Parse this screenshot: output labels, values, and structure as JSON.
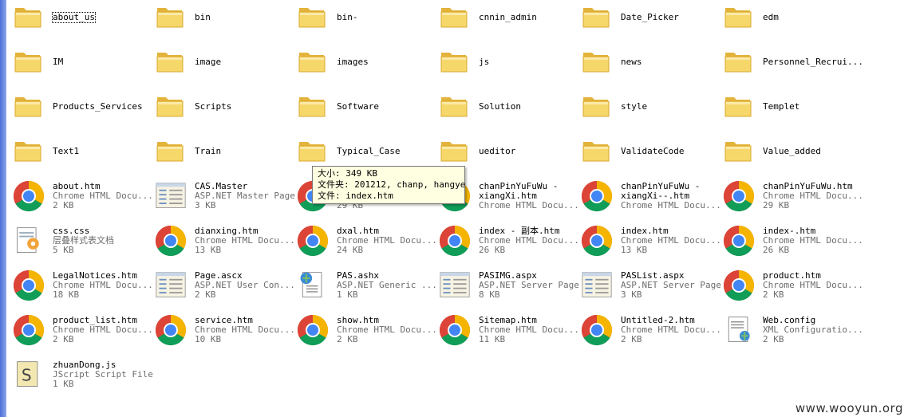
{
  "folders": [
    {
      "name": "about_us",
      "selected": true
    },
    {
      "name": "bin"
    },
    {
      "name": "bin-"
    },
    {
      "name": "cnnin_admin"
    },
    {
      "name": "Date_Picker"
    },
    {
      "name": "edm"
    },
    {
      "name": "IM"
    },
    {
      "name": "image"
    },
    {
      "name": "images"
    },
    {
      "name": "js"
    },
    {
      "name": "news"
    },
    {
      "name": "Personnel_Recrui..."
    },
    {
      "name": "Products_Services"
    },
    {
      "name": "Scripts"
    },
    {
      "name": "Software"
    },
    {
      "name": "Solution"
    },
    {
      "name": "style"
    },
    {
      "name": "Templet"
    },
    {
      "name": "Text1"
    },
    {
      "name": "Train"
    },
    {
      "name": "Typical_Case"
    },
    {
      "name": "ueditor"
    },
    {
      "name": "ValidateCode"
    },
    {
      "name": "Value_added"
    }
  ],
  "files": [
    {
      "name": "about.htm",
      "type": "Chrome HTML Docu...",
      "size": "2 KB",
      "icon": "chrome-icon"
    },
    {
      "name": "CAS.Master",
      "type": "ASP.NET Master Page",
      "size": "3 KB",
      "icon": "master-page-icon"
    },
    {
      "name": "",
      "type": "",
      "size": "29 KB",
      "icon": "chrome-icon"
    },
    {
      "name": "chanPinYuFuWu -",
      "name2": "xiangXi.htm",
      "type": "Chrome HTML Docu...",
      "size": "",
      "icon": "chrome-icon"
    },
    {
      "name": "chanPinYuFuWu -",
      "name2": "xiangXi--.htm",
      "type": "Chrome HTML Docu...",
      "size": "",
      "icon": "chrome-icon"
    },
    {
      "name": "chanPinYuFuWu.htm",
      "type": "Chrome HTML Docu...",
      "size": "29 KB",
      "icon": "chrome-icon"
    },
    {
      "name": "css.css",
      "type": "层叠样式表文档",
      "size": "5 KB",
      "icon": "css-icon"
    },
    {
      "name": "dianxing.htm",
      "type": "Chrome HTML Docu...",
      "size": "13 KB",
      "icon": "chrome-icon"
    },
    {
      "name": "dxal.htm",
      "type": "Chrome HTML Docu...",
      "size": "24 KB",
      "icon": "chrome-icon"
    },
    {
      "name": "index - 副本.htm",
      "type": "Chrome HTML Docu...",
      "size": "26 KB",
      "icon": "chrome-icon"
    },
    {
      "name": "index.htm",
      "type": "Chrome HTML Docu...",
      "size": "13 KB",
      "icon": "chrome-icon"
    },
    {
      "name": "index-.htm",
      "type": "Chrome HTML Docu...",
      "size": "26 KB",
      "icon": "chrome-icon"
    },
    {
      "name": "LegalNotices.htm",
      "type": "Chrome HTML Docu...",
      "size": "18 KB",
      "icon": "chrome-icon"
    },
    {
      "name": "Page.ascx",
      "type": "ASP.NET User Con...",
      "size": "2 KB",
      "icon": "user-control-icon"
    },
    {
      "name": "PAS.ashx",
      "type": "ASP.NET Generic ...",
      "size": "1 KB",
      "icon": "generic-handler-icon"
    },
    {
      "name": "PASIMG.aspx",
      "type": "ASP.NET Server Page",
      "size": "8 KB",
      "icon": "server-page-icon"
    },
    {
      "name": "PASList.aspx",
      "type": "ASP.NET Server Page",
      "size": "3 KB",
      "icon": "server-page-icon"
    },
    {
      "name": "product.htm",
      "type": "Chrome HTML Docu...",
      "size": "2 KB",
      "icon": "chrome-icon"
    },
    {
      "name": "product_list.htm",
      "type": "Chrome HTML Docu...",
      "size": "2 KB",
      "icon": "chrome-icon"
    },
    {
      "name": "service.htm",
      "type": "Chrome HTML Docu...",
      "size": "10 KB",
      "icon": "chrome-icon"
    },
    {
      "name": "show.htm",
      "type": "Chrome HTML Docu...",
      "size": "2 KB",
      "icon": "chrome-icon"
    },
    {
      "name": "Sitemap.htm",
      "type": "Chrome HTML Docu...",
      "size": "11 KB",
      "icon": "chrome-icon"
    },
    {
      "name": "Untitled-2.htm",
      "type": "Chrome HTML Docu...",
      "size": "2 KB",
      "icon": "chrome-icon"
    },
    {
      "name": "Web.config",
      "type": "XML Configuratio...",
      "size": "2 KB",
      "icon": "config-icon"
    },
    {
      "name": "zhuanDong.js",
      "type": "JScript Script File",
      "size": "1 KB",
      "icon": "jscript-icon"
    }
  ],
  "tooltip": {
    "line1": "大小: 349 KB",
    "line2": "文件夹: 201212, chanp, hangye",
    "line3": "文件: index.htm"
  },
  "watermark": "www.wooyun.org",
  "colors": {
    "folder": "#f6d76a",
    "folder_dark": "#e3b33b",
    "tooltip_bg": "#ffffe1",
    "meta_text": "#6d6d6d"
  }
}
